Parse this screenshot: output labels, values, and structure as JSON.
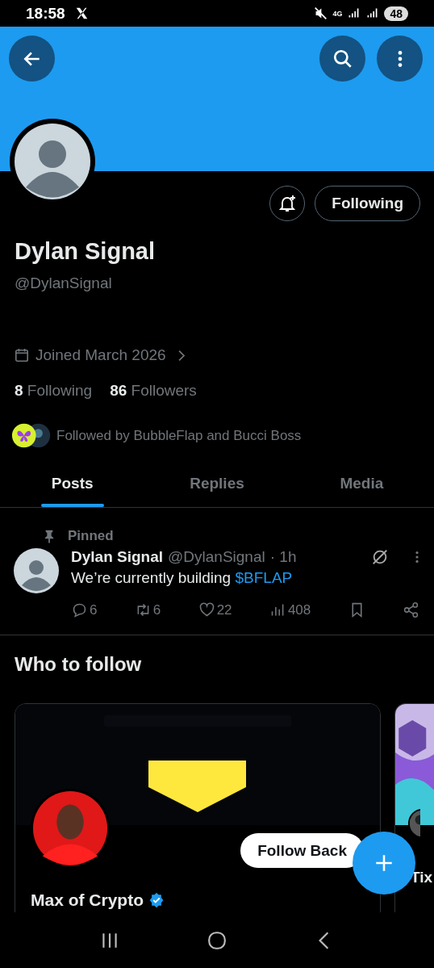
{
  "status_bar": {
    "time": "18:58",
    "network": "4G",
    "battery": "48"
  },
  "profile": {
    "name": "Dylan Signal",
    "handle": "@DylanSignal",
    "joined": "Joined March 2026",
    "following_count": "8",
    "following_label": "Following",
    "followers_count": "86",
    "followers_label": "Followers",
    "followed_by": "Followed by BubbleFlap and Bucci Boss",
    "follow_button": "Following"
  },
  "tabs": [
    {
      "label": "Posts",
      "selected": true
    },
    {
      "label": "Replies",
      "selected": false
    },
    {
      "label": "Media",
      "selected": false
    }
  ],
  "pinned_post": {
    "pinned_label": "Pinned",
    "name": "Dylan Signal",
    "handle": "@DylanSignal",
    "time": "· 1h",
    "text": "We’re currently building",
    "cashtag": "$BFLAP",
    "replies": "6",
    "reposts": "6",
    "likes": "22",
    "views": "408"
  },
  "who_to_follow": {
    "title": "Who to follow",
    "cards": [
      {
        "name": "Max of Crypto",
        "verified": true,
        "button": "Follow Back"
      },
      {
        "name": "Tix"
      }
    ]
  }
}
